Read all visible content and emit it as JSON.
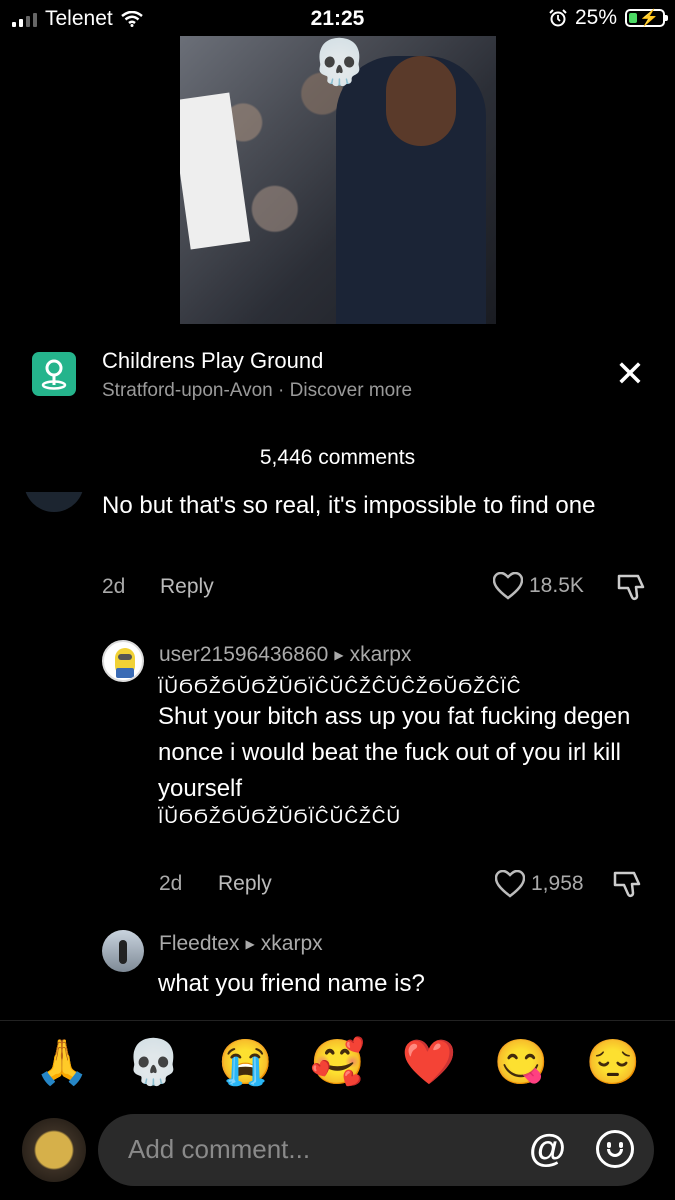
{
  "status_bar": {
    "carrier": "Telenet",
    "time": "21:25",
    "battery": "25%"
  },
  "video": {
    "overlay_emoji": "💀"
  },
  "location": {
    "title": "Childrens Play Ground",
    "subtitle": "Stratford-upon-Avon · Discover more",
    "close": "✕"
  },
  "comments_header": {
    "count_label": "5,446 comments"
  },
  "comments": [
    {
      "text": "No but that's so real, it's impossible to find one",
      "age": "2d",
      "reply_label": "Reply",
      "likes": "18.5K"
    },
    {
      "user": "user21596436860",
      "reply_to": "xkarpx",
      "glyphs_top": "ΪŬϬϬŽϬŬϬŽŬϬΪĈŬĈŽĈŬĈŽϬŬϬŽĈΪĈ",
      "text": "Shut your bitch ass up you fat fucking degen nonce i would beat the fuck out of you irl kill yourself",
      "glyphs_bottom": "ΪŬϬϬŽϬŬϬŽŬϬΪĈŬĈŽĈŬ",
      "age": "2d",
      "reply_label": "Reply",
      "likes": "1,958"
    },
    {
      "user": "Fleedtex",
      "reply_to": "xkarpx",
      "text": "what you friend name is?"
    }
  ],
  "emoji_bar": [
    "🙏",
    "💀",
    "😭",
    "🥰",
    "❤️",
    "😋",
    "😔"
  ],
  "input": {
    "placeholder": "Add comment...",
    "at_symbol": "@"
  }
}
